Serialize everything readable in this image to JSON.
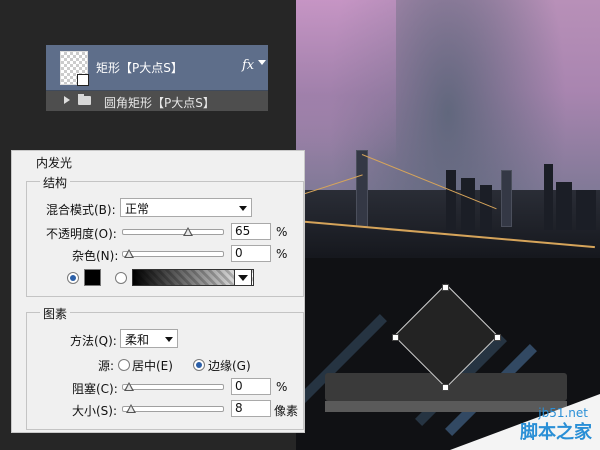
{
  "layers": {
    "shape_layer_name": "矩形【P大点S】",
    "fx_label": "fx",
    "group_layer_name": "圆角矩形【P大点S】"
  },
  "dialog": {
    "title": "内发光",
    "structure": {
      "title": "结构",
      "blend_mode_label": "混合模式(B):",
      "blend_mode_value": "正常",
      "opacity_label": "不透明度(O):",
      "opacity_value": "65",
      "opacity_unit": "%",
      "noise_label": "杂色(N):",
      "noise_value": "0",
      "noise_unit": "%",
      "color_radio_selected": true,
      "gradient_radio_selected": false
    },
    "elements": {
      "title": "图素",
      "technique_label": "方法(Q):",
      "technique_value": "柔和",
      "source_label": "源:",
      "source_center_label": "居中(E)",
      "source_edge_label": "边缘(G)",
      "source_selected": "edge",
      "choke_label": "阻塞(C):",
      "choke_value": "0",
      "choke_unit": "%",
      "size_label": "大小(S):",
      "size_value": "8",
      "size_unit": "像素"
    }
  },
  "watermark": {
    "site": "jb51.net",
    "name": "脚本之家"
  },
  "colors": {
    "layer_selected": "#5e6e8a",
    "accent_radio": "#2b5fa8",
    "glow_color": "#000000",
    "watermark_blue": "#2a8fd6"
  }
}
